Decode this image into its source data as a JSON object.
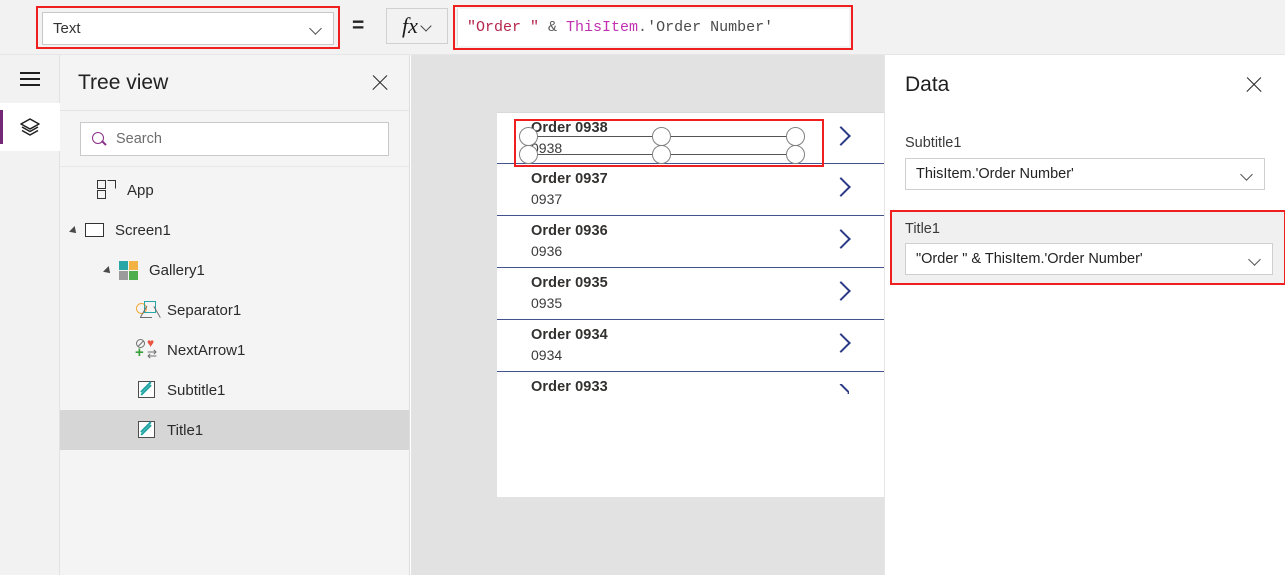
{
  "topbar": {
    "property_dropdown": {
      "value": "Text",
      "icon": "chevron-down-icon"
    },
    "equals": "=",
    "fx_label": "fx",
    "formula": {
      "full_text": "\"Order \" & ThisItem.'Order Number'",
      "tokens": [
        {
          "text": "\"Order \"",
          "kind": "string"
        },
        {
          "text": " & ",
          "kind": "operator"
        },
        {
          "text": "ThisItem",
          "kind": "keyword"
        },
        {
          "text": ".",
          "kind": "operator"
        },
        {
          "text": "'Order Number'",
          "kind": "identifier"
        }
      ],
      "colors": {
        "string": "#b5254c",
        "keyword": "#c030b0",
        "operator": "#5a5a5a",
        "identifier": "#4a4a4a"
      }
    }
  },
  "rail": {
    "menu_icon": "hamburger-icon",
    "layers_icon": "layers-icon",
    "active_accent": "#742774"
  },
  "tree": {
    "title": "Tree view",
    "close_icon": "close-icon",
    "search": {
      "placeholder": "Search",
      "icon": "search-icon"
    },
    "items": [
      {
        "label": "App",
        "icon": "app-icon",
        "indent": 0,
        "expandable": false,
        "selected": false
      },
      {
        "label": "Screen1",
        "icon": "screen-icon",
        "indent": 0,
        "expandable": true,
        "selected": false
      },
      {
        "label": "Gallery1",
        "icon": "gallery-icon",
        "indent": 1,
        "expandable": true,
        "selected": false
      },
      {
        "label": "Separator1",
        "icon": "separator-icon",
        "indent": 2,
        "expandable": false,
        "selected": false
      },
      {
        "label": "NextArrow1",
        "icon": "nextarrow-icon",
        "indent": 2,
        "expandable": false,
        "selected": false
      },
      {
        "label": "Subtitle1",
        "icon": "label-icon",
        "indent": 2,
        "expandable": false,
        "selected": false
      },
      {
        "label": "Title1",
        "icon": "label-icon",
        "indent": 2,
        "expandable": false,
        "selected": true
      }
    ],
    "selection_color": "#d6d6d6"
  },
  "canvas": {
    "background": "#e2e2e2",
    "gallery": {
      "items": [
        {
          "title": "Order 0938",
          "subtitle": "0938",
          "selected": true
        },
        {
          "title": "Order 0937",
          "subtitle": "0937",
          "selected": false
        },
        {
          "title": "Order 0936",
          "subtitle": "0936",
          "selected": false
        },
        {
          "title": "Order 0935",
          "subtitle": "0935",
          "selected": false
        },
        {
          "title": "Order 0934",
          "subtitle": "0934",
          "selected": false
        },
        {
          "title": "Order 0933",
          "subtitle": "",
          "selected": false
        }
      ],
      "chevron_icon": "chevron-right-icon",
      "separator_color": "#41528c"
    }
  },
  "data_panel": {
    "title": "Data",
    "close_icon": "close-icon",
    "fields": [
      {
        "label": "Subtitle1",
        "value": "ThisItem.'Order Number'",
        "highlighted": false
      },
      {
        "label": "Title1",
        "value": "\"Order \" & ThisItem.'Order Number'",
        "highlighted": true
      }
    ]
  },
  "annotations": {
    "highlight_color": "#f01f1f"
  }
}
